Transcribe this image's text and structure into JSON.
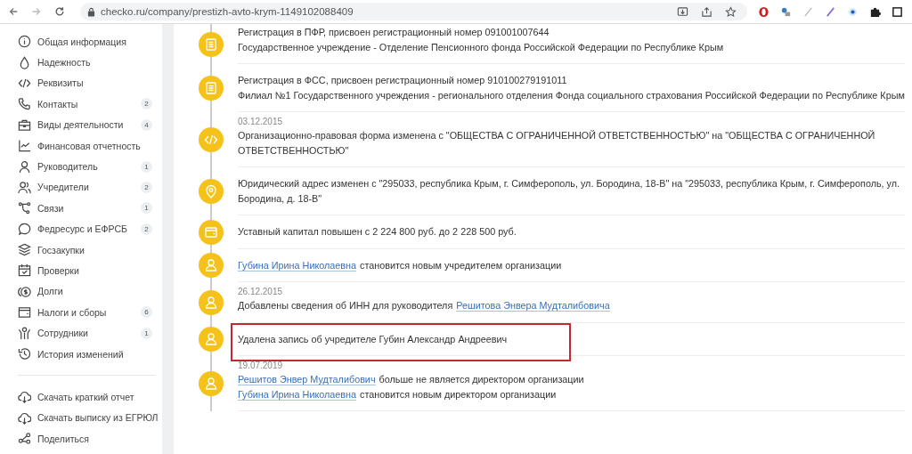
{
  "browser": {
    "url": "checko.ru/company/prestizh-avto-krym-1149102088409"
  },
  "sidebar": {
    "items": [
      {
        "label": "Общая информация"
      },
      {
        "label": "Надежность"
      },
      {
        "label": "Реквизиты"
      },
      {
        "label": "Контакты",
        "badge": "2"
      },
      {
        "label": "Виды деятельности",
        "badge": "4"
      },
      {
        "label": "Финансовая отчетность"
      },
      {
        "label": "Руководитель",
        "badge": "1"
      },
      {
        "label": "Учредители",
        "badge": "2"
      },
      {
        "label": "Связи",
        "badge": "1"
      },
      {
        "label": "Федресурс и ЕФРСБ",
        "badge": "2"
      },
      {
        "label": "Госзакупки"
      },
      {
        "label": "Проверки"
      },
      {
        "label": "Долги"
      },
      {
        "label": "Налоги и сборы",
        "badge": "6"
      },
      {
        "label": "Сотрудники",
        "badge": "1"
      },
      {
        "label": "История изменений"
      }
    ],
    "actions": [
      {
        "label": "Скачать краткий отчет"
      },
      {
        "label": "Скачать выписку из ЕГРЮЛ"
      },
      {
        "label": "Поделиться"
      }
    ]
  },
  "events": [
    {
      "kind": "registration",
      "highlighted": false,
      "lines": [
        [
          {
            "kind": "text",
            "text": "Регистрация в ПФР, присвоен регистрационный номер 091001007644"
          }
        ],
        [
          {
            "kind": "text",
            "text": "Государственное учреждение - Отделение Пенсионного фонда Российской Федерации по Республике Крым"
          }
        ]
      ]
    },
    {
      "kind": "registration",
      "highlighted": false,
      "lines": [
        [
          {
            "kind": "text",
            "text": "Регистрация в ФСС, присвоен регистрационный номер 910100279191011"
          }
        ],
        [
          {
            "kind": "text",
            "text": "Филиал №1 Государственного учреждения - регионального отделения Фонда социального страхования Российской Федерации по Республике Крым"
          }
        ]
      ]
    },
    {
      "kind": "legal_form",
      "date": "03.12.2015",
      "highlighted": false,
      "lines": [
        [
          {
            "kind": "text",
            "text": "Организационно-правовая форма изменена с \"ОБЩЕСТВА С ОГРАНИЧЕННОЙ ОТВЕТСТВЕННОСТЬЮ\" на \"ОБЩЕСТВА С ОГРАНИЧЕННОЙ ОТВЕТСТВЕННОСТЬЮ\""
          }
        ]
      ]
    },
    {
      "kind": "address",
      "highlighted": false,
      "lines": [
        [
          {
            "kind": "text",
            "text": "Юридический адрес изменен с \"295033, республика Крым, г. Симферополь, ул. Бородина, 18-В\" на \"295033, республика Крым, г. Симферополь, ул. Бородина, д. 18-В\""
          }
        ]
      ]
    },
    {
      "kind": "capital",
      "highlighted": false,
      "lines": [
        [
          {
            "kind": "text",
            "text": "Уставный капитал повышен с 2 224 800 руб. до 2 228 500 руб."
          }
        ]
      ]
    },
    {
      "kind": "person",
      "highlighted": false,
      "lines": [
        [
          {
            "kind": "link",
            "text": "Губина Ирина Николаевна"
          },
          {
            "kind": "text",
            "text": "становится новым учредителем организации"
          }
        ]
      ]
    },
    {
      "kind": "person",
      "date": "26.12.2015",
      "highlighted": false,
      "lines": [
        [
          {
            "kind": "text",
            "text": "Добавлены сведения об ИНН для руководителя"
          },
          {
            "kind": "link",
            "text": "Решитова Энвера Мудталибовича"
          }
        ]
      ]
    },
    {
      "kind": "person",
      "highlighted": true,
      "lines": [
        [
          {
            "kind": "text",
            "text": "Удалена запись об учредителе Губин Александр Андреевич"
          }
        ]
      ]
    },
    {
      "kind": "person",
      "date": "19.07.2019",
      "highlighted": false,
      "lines": [
        [
          {
            "kind": "link",
            "text": "Решитов Энвер Мудталибович"
          },
          {
            "kind": "text",
            "text": "больше не является директором организации"
          }
        ],
        [
          {
            "kind": "link",
            "text": "Губина Ирина Николаевна"
          },
          {
            "kind": "text",
            "text": "становится новым директором организации"
          }
        ]
      ]
    }
  ]
}
